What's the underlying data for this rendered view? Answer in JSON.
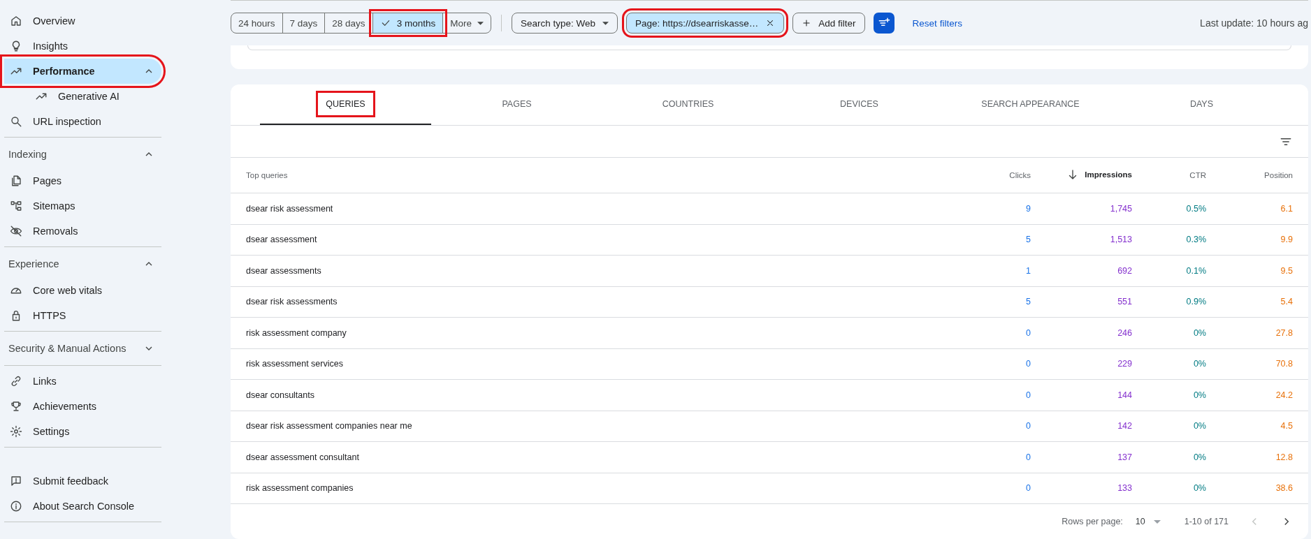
{
  "sidebar": {
    "sections": [
      {
        "items": [
          {
            "label": "Overview",
            "selected": false,
            "annotated": false
          },
          {
            "label": "Insights",
            "selected": false,
            "annotated": false
          },
          {
            "label": "Performance",
            "selected": true,
            "expanded": true,
            "annotated": true,
            "children": [
              {
                "label": "Generative AI",
                "selected": false
              }
            ]
          },
          {
            "label": "URL inspection",
            "selected": false,
            "annotated": false
          }
        ]
      },
      {
        "title": "Indexing",
        "expanded": true,
        "items": [
          {
            "label": "Pages",
            "selected": false,
            "annotated": false
          },
          {
            "label": "Sitemaps",
            "selected": false,
            "annotated": false
          },
          {
            "label": "Removals",
            "selected": false,
            "annotated": false
          }
        ]
      },
      {
        "title": "Experience",
        "expanded": true,
        "items": [
          {
            "label": "Core web vitals",
            "selected": false,
            "annotated": false
          },
          {
            "label": "HTTPS",
            "selected": false,
            "annotated": false
          }
        ]
      },
      {
        "title": "Security & Manual Actions",
        "expanded": false
      },
      {
        "items": [
          {
            "label": "Links",
            "selected": false,
            "annotated": false
          },
          {
            "label": "Achievements",
            "selected": false,
            "annotated": false
          },
          {
            "label": "Settings",
            "selected": false,
            "annotated": false
          }
        ]
      },
      {
        "items": [
          {
            "label": "Submit feedback",
            "selected": false,
            "annotated": false
          },
          {
            "label": "About Search Console",
            "selected": false,
            "annotated": false
          }
        ]
      }
    ]
  },
  "filter_bar": {
    "date_ranges": [
      {
        "label": "24 hours",
        "selected": false,
        "annotated": false
      },
      {
        "label": "7 days",
        "selected": false,
        "annotated": false
      },
      {
        "label": "28 days",
        "selected": false,
        "annotated": false
      },
      {
        "label": "3 months",
        "selected": true,
        "annotated": true
      }
    ],
    "more": "More",
    "search_type": "Search type: Web",
    "page_filter": {
      "label": "Page: https://dsearriskasse…",
      "annotated": true
    },
    "add_filter": "Add filter",
    "reset": "Reset filters",
    "last_update": "Last update: 10 hours ag"
  },
  "tabs": [
    {
      "label": "QUERIES",
      "selected": true,
      "annotated": true
    },
    {
      "label": "PAGES",
      "selected": false,
      "annotated": false
    },
    {
      "label": "COUNTRIES",
      "selected": false,
      "annotated": false
    },
    {
      "label": "DEVICES",
      "selected": false,
      "annotated": false
    },
    {
      "label": "SEARCH APPEARANCE",
      "selected": false,
      "annotated": false
    },
    {
      "label": "DAYS",
      "selected": false,
      "annotated": false
    }
  ],
  "table": {
    "columns": [
      {
        "label": "Top queries",
        "sorted": false
      },
      {
        "label": "Clicks",
        "sorted": false
      },
      {
        "label": "Impressions",
        "sorted": true
      },
      {
        "label": "CTR",
        "sorted": false
      },
      {
        "label": "Position",
        "sorted": false
      }
    ],
    "rows": [
      [
        "dsear risk assessment",
        "9",
        "1,745",
        "0.5%",
        "6.1"
      ],
      [
        "dsear assessment",
        "5",
        "1,513",
        "0.3%",
        "9.9"
      ],
      [
        "dsear assessments",
        "1",
        "692",
        "0.1%",
        "9.5"
      ],
      [
        "dsear risk assessments",
        "5",
        "551",
        "0.9%",
        "5.4"
      ],
      [
        "risk assessment company",
        "0",
        "246",
        "0%",
        "27.8"
      ],
      [
        "risk assessment services",
        "0",
        "229",
        "0%",
        "70.8"
      ],
      [
        "dsear consultants",
        "0",
        "144",
        "0%",
        "24.2"
      ],
      [
        "dsear risk assessment companies near me",
        "0",
        "142",
        "0%",
        "4.5"
      ],
      [
        "dsear assessment consultant",
        "0",
        "137",
        "0%",
        "12.8"
      ],
      [
        "risk assessment companies",
        "0",
        "133",
        "0%",
        "38.6"
      ]
    ]
  },
  "pagination": {
    "rows_per_page_label": "Rows per page:",
    "rows_per_page": "10",
    "range": "1-10 of 171"
  }
}
